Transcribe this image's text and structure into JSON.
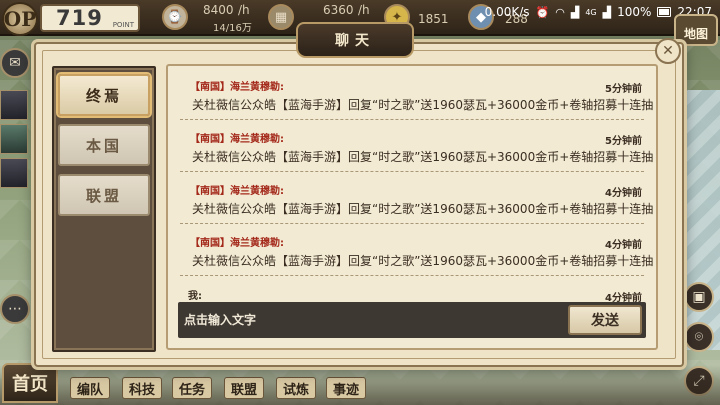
{
  "hud": {
    "logo": "OP",
    "power_value": "719",
    "power_unit": "POINT",
    "resource1_value": "8400",
    "resource1_rate": "/h",
    "resource1_sub": "14/16万",
    "resource2_value": "6360",
    "resource2_rate": "/h",
    "resource3_value": "1851",
    "resource4_value": "288"
  },
  "status_bar": {
    "network_speed": "0.00K/s",
    "signal": "4G",
    "battery": "100%",
    "time": "22:07"
  },
  "map_button_label": "地图",
  "chat": {
    "title": "聊天",
    "tabs": [
      {
        "label": "终焉",
        "active": true
      },
      {
        "label": "本国",
        "active": false
      },
      {
        "label": "联盟",
        "active": false
      }
    ],
    "messages": [
      {
        "sender": "【南国】海兰黄穆勒:",
        "time": "5分钟前",
        "text": "关杜薇信公众皓【蓝海手游】回复“时之歌”送1960瑟瓦+36000金币+卷轴招募十连抽"
      },
      {
        "sender": "【南国】海兰黄穆勒:",
        "time": "5分钟前",
        "text": "关杜薇信公众皓【蓝海手游】回复“时之歌”送1960瑟瓦+36000金币+卷轴招募十连抽"
      },
      {
        "sender": "【南国】海兰黄穆勒:",
        "time": "4分钟前",
        "text": "关杜薇信公众皓【蓝海手游】回复“时之歌”送1960瑟瓦+36000金币+卷轴招募十连抽"
      },
      {
        "sender": "【南国】海兰黄穆勒:",
        "time": "4分钟前",
        "text": "关杜薇信公众皓【蓝海手游】回复“时之歌”送1960瑟瓦+36000金币+卷轴招募十连抽"
      }
    ],
    "my_label": "我:",
    "my_time": "4分钟前",
    "input_placeholder": "点击输入文字",
    "send_label": "发送"
  },
  "bottom_nav": {
    "home": "首页",
    "items": [
      "编队",
      "科技",
      "任务",
      "联盟",
      "试炼",
      "事迹"
    ]
  },
  "icons": {
    "close": "close-icon",
    "mail": "mail-icon",
    "chat": "chat-bubble-icon",
    "bag": "bag-icon",
    "location": "location-icon",
    "fullscreen": "fullscreen-icon"
  }
}
